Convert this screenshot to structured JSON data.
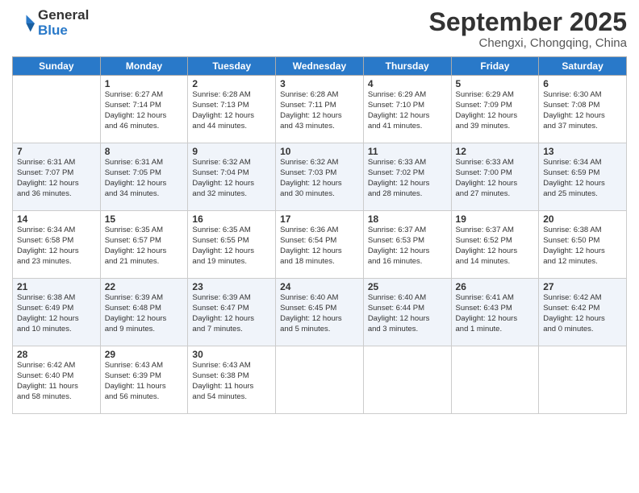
{
  "logo": {
    "line1": "General",
    "line2": "Blue"
  },
  "title": "September 2025",
  "subtitle": "Chengxi, Chongqing, China",
  "headers": [
    "Sunday",
    "Monday",
    "Tuesday",
    "Wednesday",
    "Thursday",
    "Friday",
    "Saturday"
  ],
  "weeks": [
    [
      {
        "day": "",
        "info": ""
      },
      {
        "day": "1",
        "info": "Sunrise: 6:27 AM\nSunset: 7:14 PM\nDaylight: 12 hours\nand 46 minutes."
      },
      {
        "day": "2",
        "info": "Sunrise: 6:28 AM\nSunset: 7:13 PM\nDaylight: 12 hours\nand 44 minutes."
      },
      {
        "day": "3",
        "info": "Sunrise: 6:28 AM\nSunset: 7:11 PM\nDaylight: 12 hours\nand 43 minutes."
      },
      {
        "day": "4",
        "info": "Sunrise: 6:29 AM\nSunset: 7:10 PM\nDaylight: 12 hours\nand 41 minutes."
      },
      {
        "day": "5",
        "info": "Sunrise: 6:29 AM\nSunset: 7:09 PM\nDaylight: 12 hours\nand 39 minutes."
      },
      {
        "day": "6",
        "info": "Sunrise: 6:30 AM\nSunset: 7:08 PM\nDaylight: 12 hours\nand 37 minutes."
      }
    ],
    [
      {
        "day": "7",
        "info": "Sunrise: 6:31 AM\nSunset: 7:07 PM\nDaylight: 12 hours\nand 36 minutes."
      },
      {
        "day": "8",
        "info": "Sunrise: 6:31 AM\nSunset: 7:05 PM\nDaylight: 12 hours\nand 34 minutes."
      },
      {
        "day": "9",
        "info": "Sunrise: 6:32 AM\nSunset: 7:04 PM\nDaylight: 12 hours\nand 32 minutes."
      },
      {
        "day": "10",
        "info": "Sunrise: 6:32 AM\nSunset: 7:03 PM\nDaylight: 12 hours\nand 30 minutes."
      },
      {
        "day": "11",
        "info": "Sunrise: 6:33 AM\nSunset: 7:02 PM\nDaylight: 12 hours\nand 28 minutes."
      },
      {
        "day": "12",
        "info": "Sunrise: 6:33 AM\nSunset: 7:00 PM\nDaylight: 12 hours\nand 27 minutes."
      },
      {
        "day": "13",
        "info": "Sunrise: 6:34 AM\nSunset: 6:59 PM\nDaylight: 12 hours\nand 25 minutes."
      }
    ],
    [
      {
        "day": "14",
        "info": "Sunrise: 6:34 AM\nSunset: 6:58 PM\nDaylight: 12 hours\nand 23 minutes."
      },
      {
        "day": "15",
        "info": "Sunrise: 6:35 AM\nSunset: 6:57 PM\nDaylight: 12 hours\nand 21 minutes."
      },
      {
        "day": "16",
        "info": "Sunrise: 6:35 AM\nSunset: 6:55 PM\nDaylight: 12 hours\nand 19 minutes."
      },
      {
        "day": "17",
        "info": "Sunrise: 6:36 AM\nSunset: 6:54 PM\nDaylight: 12 hours\nand 18 minutes."
      },
      {
        "day": "18",
        "info": "Sunrise: 6:37 AM\nSunset: 6:53 PM\nDaylight: 12 hours\nand 16 minutes."
      },
      {
        "day": "19",
        "info": "Sunrise: 6:37 AM\nSunset: 6:52 PM\nDaylight: 12 hours\nand 14 minutes."
      },
      {
        "day": "20",
        "info": "Sunrise: 6:38 AM\nSunset: 6:50 PM\nDaylight: 12 hours\nand 12 minutes."
      }
    ],
    [
      {
        "day": "21",
        "info": "Sunrise: 6:38 AM\nSunset: 6:49 PM\nDaylight: 12 hours\nand 10 minutes."
      },
      {
        "day": "22",
        "info": "Sunrise: 6:39 AM\nSunset: 6:48 PM\nDaylight: 12 hours\nand 9 minutes."
      },
      {
        "day": "23",
        "info": "Sunrise: 6:39 AM\nSunset: 6:47 PM\nDaylight: 12 hours\nand 7 minutes."
      },
      {
        "day": "24",
        "info": "Sunrise: 6:40 AM\nSunset: 6:45 PM\nDaylight: 12 hours\nand 5 minutes."
      },
      {
        "day": "25",
        "info": "Sunrise: 6:40 AM\nSunset: 6:44 PM\nDaylight: 12 hours\nand 3 minutes."
      },
      {
        "day": "26",
        "info": "Sunrise: 6:41 AM\nSunset: 6:43 PM\nDaylight: 12 hours\nand 1 minute."
      },
      {
        "day": "27",
        "info": "Sunrise: 6:42 AM\nSunset: 6:42 PM\nDaylight: 12 hours\nand 0 minutes."
      }
    ],
    [
      {
        "day": "28",
        "info": "Sunrise: 6:42 AM\nSunset: 6:40 PM\nDaylight: 11 hours\nand 58 minutes."
      },
      {
        "day": "29",
        "info": "Sunrise: 6:43 AM\nSunset: 6:39 PM\nDaylight: 11 hours\nand 56 minutes."
      },
      {
        "day": "30",
        "info": "Sunrise: 6:43 AM\nSunset: 6:38 PM\nDaylight: 11 hours\nand 54 minutes."
      },
      {
        "day": "",
        "info": ""
      },
      {
        "day": "",
        "info": ""
      },
      {
        "day": "",
        "info": ""
      },
      {
        "day": "",
        "info": ""
      }
    ]
  ]
}
